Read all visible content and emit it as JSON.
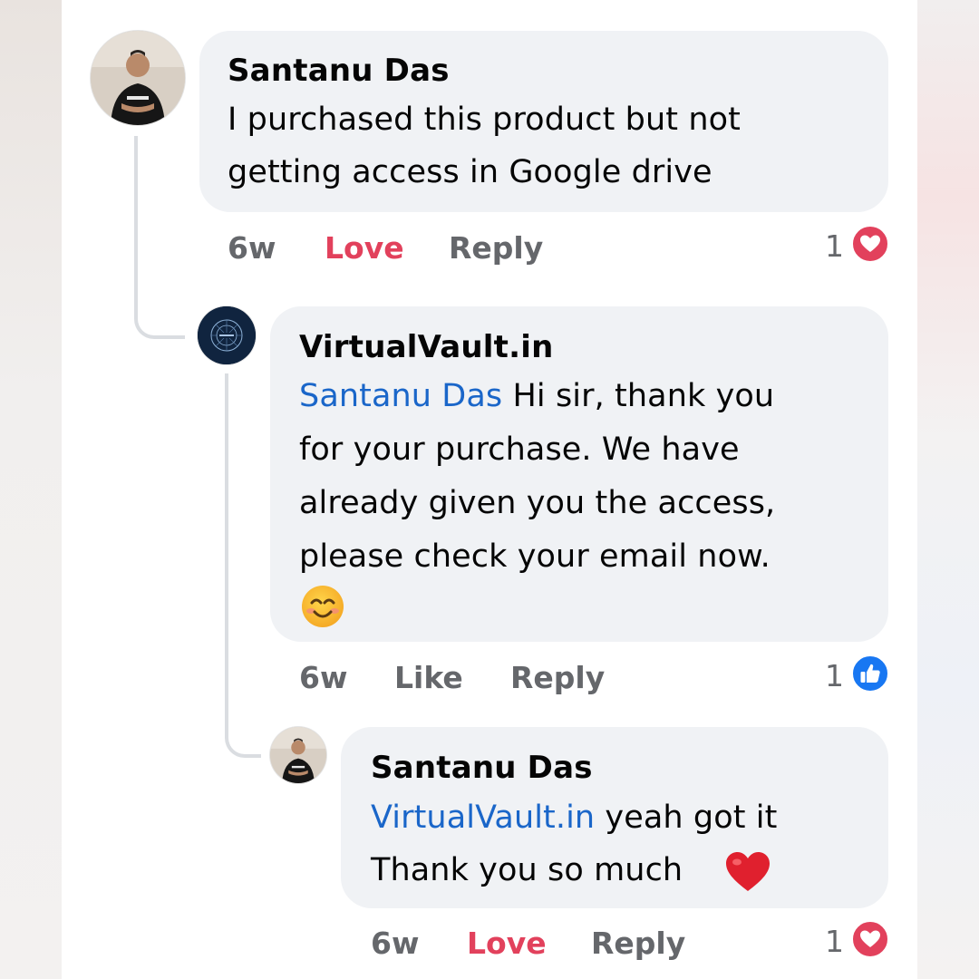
{
  "comments": [
    {
      "author": "Santanu Das",
      "text_lines": [
        "I purchased this product but not",
        "getting access in Google drive"
      ],
      "time": "6w",
      "action_reaction": "Love",
      "action_reply": "Reply",
      "reaction_count": "1",
      "reaction_icon": "heart-icon",
      "reaction_color": "#e2415c"
    },
    {
      "author": "VirtualVault.in",
      "mention": "Santanu Das",
      "text_first_rest": " Hi sir, thank you",
      "text_lines": [
        "for your purchase. We have",
        "already given you the access,",
        "please check your email now."
      ],
      "emoji": "smiling-face-emoji",
      "time": "6w",
      "action_reaction": "Like",
      "action_reply": "Reply",
      "reaction_count": "1",
      "reaction_icon": "thumbs-up-icon",
      "reaction_color": "#1877f2"
    },
    {
      "author": "Santanu Das",
      "mention": "VirtualVault.in",
      "text_first_rest": " yeah got it",
      "text_lines": [
        "Thank you so much"
      ],
      "emoji": "red-heart-emoji",
      "time": "6w",
      "action_reaction": "Love",
      "action_reply": "Reply",
      "reaction_count": "1",
      "reaction_icon": "heart-icon",
      "reaction_color": "#e2415c"
    }
  ],
  "colors": {
    "bubble": "#f0f2f5",
    "mention": "#1a66c9",
    "meta": "#65676b",
    "love": "#e2415c",
    "like": "#1877f2"
  }
}
